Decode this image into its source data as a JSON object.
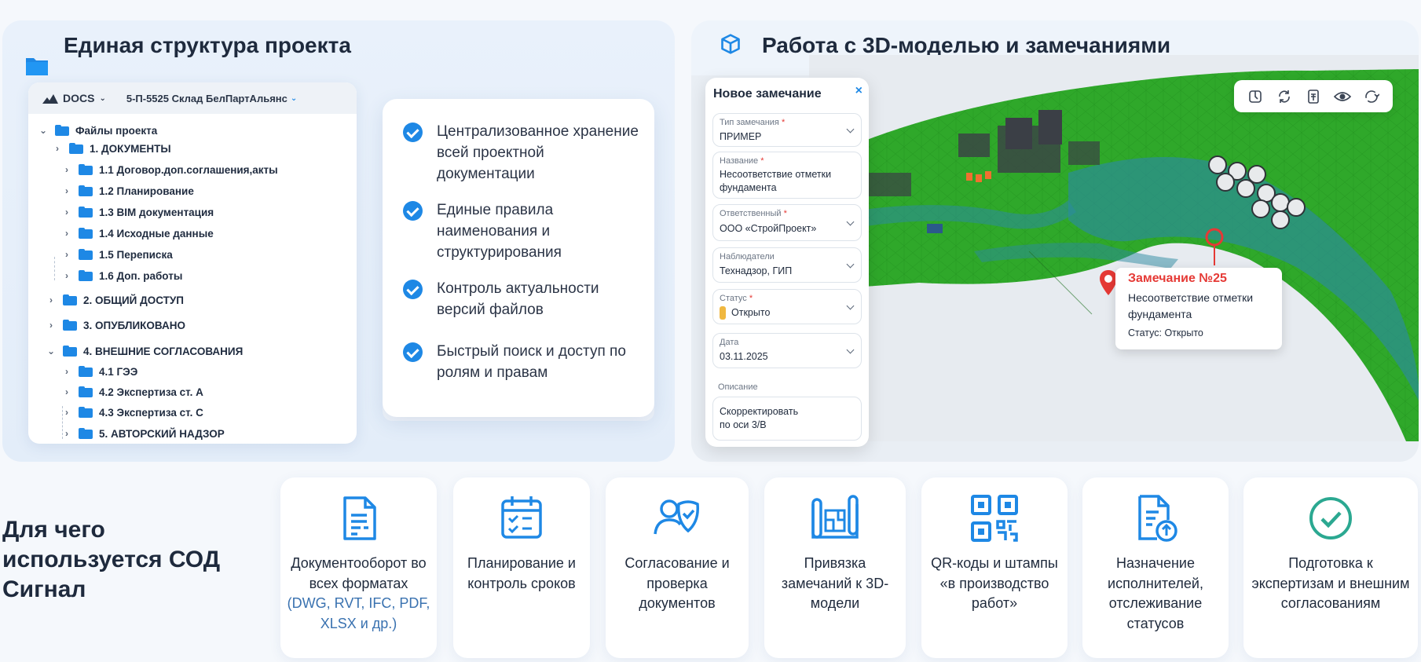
{
  "colors": {
    "accent": "#1e88e5",
    "teal": "#2a9d8f",
    "alert": "#e53935",
    "status_open": "#f0b840",
    "terrain": "#2fa82a"
  },
  "left_panel": {
    "title": "Единая структура проекта",
    "icon": "folder-icon",
    "tree": {
      "root_label": "DOCS",
      "project": "5-П-5525 Склад БелПартАльянс",
      "items": [
        {
          "label": "Файлы проекта"
        },
        {
          "label": "1. ДОКУМЕНТЫ"
        },
        {
          "label": "1.1 Договор.доп.соглашения,акты"
        },
        {
          "label": "1.2 Планирование"
        },
        {
          "label": "1.3 BIM документация"
        },
        {
          "label": "1.4 Исходные данные"
        },
        {
          "label": "1.5 Переписка"
        },
        {
          "label": "1.6 Доп. работы"
        },
        {
          "label": "2. ОБЩИЙ ДОСТУП"
        },
        {
          "label": "3. ОПУБЛИКОВАНО"
        },
        {
          "label": "4. ВНЕШНИЕ СОГЛАСОВАНИЯ"
        },
        {
          "label": "4.1 ГЭЭ"
        },
        {
          "label": "4.2 Экспертиза ст. А"
        },
        {
          "label": "4.3 Экспертиза ст. С"
        },
        {
          "label": "5. АВТОРСКИЙ НАДЗОР"
        }
      ]
    },
    "features": [
      {
        "text": "Централизованное хранение всей проектной документации"
      },
      {
        "text": "Единые правила наименования и структурирования"
      },
      {
        "text": "Контроль актуальности версий файлов"
      },
      {
        "text": "Быстрый поиск и доступ по ролям и правам"
      }
    ]
  },
  "right_panel": {
    "title": "Работа с 3D-моделью и замечаниями",
    "icon": "cube-icon",
    "toolbar_icons": [
      "section-icon",
      "rotate-icon",
      "model-icon",
      "eye-icon",
      "orbit-icon"
    ],
    "form": {
      "title": "Новое замечание",
      "close": "×",
      "fields": [
        {
          "label": "Тип замечания",
          "req": "*",
          "value": "ПРИМЕР"
        },
        {
          "label": "Название",
          "req": "*",
          "value": "Несоответствие отметки фундамента"
        },
        {
          "label": "Ответственный",
          "req": "*",
          "value": "ООО «СтройПроект»"
        },
        {
          "label": "Наблюдатели",
          "req": "",
          "value": "Технадзор, ГИП"
        },
        {
          "label": "Статус",
          "req": "*",
          "value": "Открыто"
        },
        {
          "label": "Дата",
          "req": "",
          "value": "03.11.2025"
        }
      ],
      "description_label": "Описание",
      "description_value": "Скорректировать по оси 3/В"
    },
    "callout": {
      "title": "Замечание №25",
      "text": "Несоответствие отметки фундамента",
      "status": "Статус: Открыто"
    }
  },
  "bottom": {
    "title": "Для чего используется СОД Сигнал",
    "tiles": [
      {
        "icon": "document-icon",
        "text": "Документооборот во всех форматах",
        "sub": "(DWG, RVT, IFC, PDF, XLSX и др.)"
      },
      {
        "icon": "calendar-check-icon",
        "text": "Планирование и контроль сроков",
        "sub": ""
      },
      {
        "icon": "approval-icon",
        "text": "Согласование и проверка документов",
        "sub": ""
      },
      {
        "icon": "blueprint-icon",
        "text": "Привязка замечаний к 3D-модели",
        "sub": ""
      },
      {
        "icon": "qr-code-icon",
        "text": "QR-коды и штампы «в производство работ»",
        "sub": ""
      },
      {
        "icon": "assign-document-icon",
        "text": "Назначение исполнителей, отслеживание статусов",
        "sub": ""
      },
      {
        "icon": "check-circle-icon",
        "text": "Подготовка к экспертизам и внешним согласованиям",
        "sub": ""
      }
    ]
  }
}
